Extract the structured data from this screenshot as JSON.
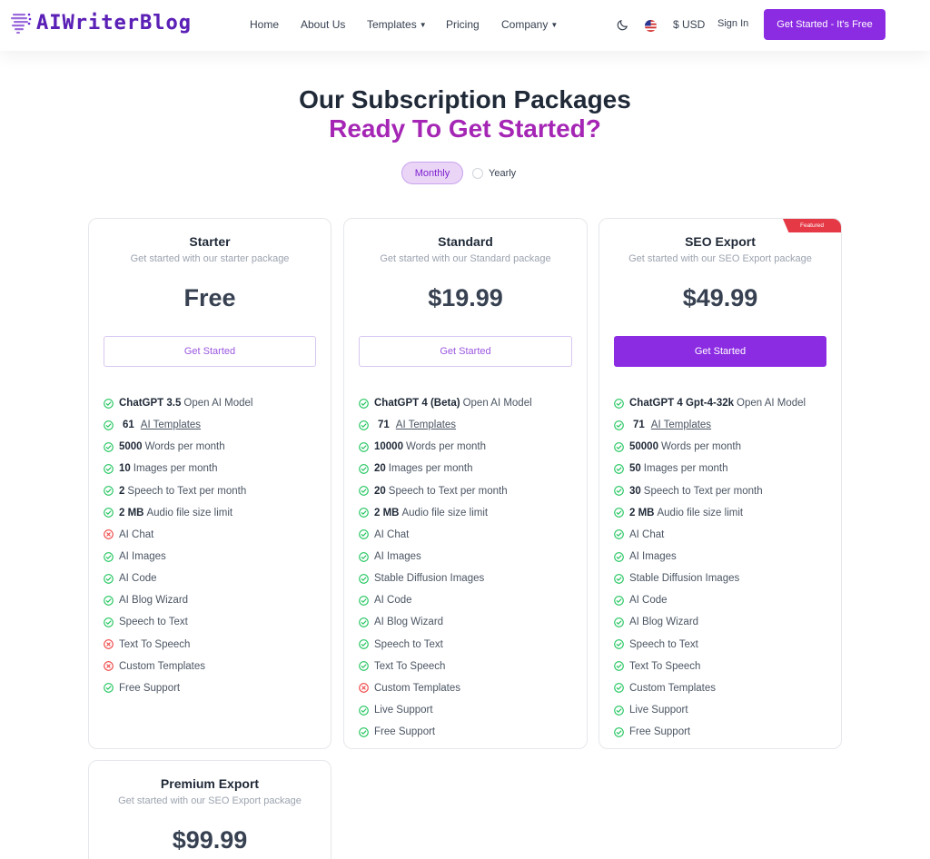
{
  "brand": {
    "name": "AIWriterBlog"
  },
  "nav": {
    "home": "Home",
    "about": "About Us",
    "templates": "Templates",
    "pricing": "Pricing",
    "company": "Company"
  },
  "header": {
    "currency": "$ USD",
    "sign_in": "Sign In",
    "cta": "Get Started - It's Free"
  },
  "hero": {
    "title": "Our Subscription Packages",
    "subtitle": "Ready To Get Started?",
    "billing_options": [
      "Monthly",
      "Yearly"
    ],
    "billing_selected": "Monthly"
  },
  "colors": {
    "accent": "#8b2be2",
    "subtitle": "#a526b5",
    "check": "#22c55e",
    "cross": "#ef4444",
    "ribbon": "#e53945"
  },
  "plans": [
    {
      "name": "Starter",
      "desc": "Get started with our starter package",
      "price": "Free",
      "button": "Get Started",
      "features": [
        {
          "ok": true,
          "b": "ChatGPT 3.5",
          "t": "Open AI Model"
        },
        {
          "ok": true,
          "n": "61",
          "t": "AI Templates",
          "link": true
        },
        {
          "ok": true,
          "b": "5000",
          "t": "Words per month"
        },
        {
          "ok": true,
          "b": "10",
          "t": "Images per month"
        },
        {
          "ok": true,
          "b": "2",
          "t": "Speech to Text per month"
        },
        {
          "ok": true,
          "b": "2 MB",
          "t": "Audio file size limit"
        },
        {
          "ok": false,
          "t": "AI Chat"
        },
        {
          "ok": true,
          "t": "AI Images"
        },
        {
          "ok": true,
          "t": "AI Code"
        },
        {
          "ok": true,
          "t": "AI Blog Wizard"
        },
        {
          "ok": true,
          "t": "Speech to Text"
        },
        {
          "ok": false,
          "t": "Text To Speech"
        },
        {
          "ok": false,
          "t": "Custom Templates"
        },
        {
          "ok": true,
          "t": "Free Support"
        }
      ]
    },
    {
      "name": "Standard",
      "desc": "Get started with our Standard package",
      "price": "$19.99",
      "button": "Get Started",
      "features": [
        {
          "ok": true,
          "b": "ChatGPT 4 (Beta)",
          "t": "Open AI Model"
        },
        {
          "ok": true,
          "n": "71",
          "t": "AI Templates",
          "link": true
        },
        {
          "ok": true,
          "b": "10000",
          "t": "Words per month"
        },
        {
          "ok": true,
          "b": "20",
          "t": "Images per month"
        },
        {
          "ok": true,
          "b": "20",
          "t": "Speech to Text per month"
        },
        {
          "ok": true,
          "b": "2 MB",
          "t": "Audio file size limit"
        },
        {
          "ok": true,
          "t": "AI Chat"
        },
        {
          "ok": true,
          "t": "AI Images"
        },
        {
          "ok": true,
          "t": "Stable Diffusion Images"
        },
        {
          "ok": true,
          "t": "AI Code"
        },
        {
          "ok": true,
          "t": "AI Blog Wizard"
        },
        {
          "ok": true,
          "t": "Speech to Text"
        },
        {
          "ok": true,
          "t": "Text To Speech"
        },
        {
          "ok": false,
          "t": "Custom Templates"
        },
        {
          "ok": true,
          "t": "Live Support"
        },
        {
          "ok": true,
          "t": "Free Support"
        }
      ]
    },
    {
      "name": "SEO Export",
      "desc": "Get started with our SEO Export package",
      "price": "$49.99",
      "button": "Get Started",
      "ribbon": "Featured",
      "features": [
        {
          "ok": true,
          "b": "ChatGPT 4 Gpt-4-32k",
          "t": "Open AI Model"
        },
        {
          "ok": true,
          "n": "71",
          "t": "AI Templates",
          "link": true
        },
        {
          "ok": true,
          "b": "50000",
          "t": "Words per month"
        },
        {
          "ok": true,
          "b": "50",
          "t": "Images per month"
        },
        {
          "ok": true,
          "b": "30",
          "t": "Speech to Text per month"
        },
        {
          "ok": true,
          "b": "2 MB",
          "t": "Audio file size limit"
        },
        {
          "ok": true,
          "t": "AI Chat"
        },
        {
          "ok": true,
          "t": "AI Images"
        },
        {
          "ok": true,
          "t": "Stable Diffusion Images"
        },
        {
          "ok": true,
          "t": "AI Code"
        },
        {
          "ok": true,
          "t": "AI Blog Wizard"
        },
        {
          "ok": true,
          "t": "Speech to Text"
        },
        {
          "ok": true,
          "t": "Text To Speech"
        },
        {
          "ok": true,
          "t": "Custom Templates"
        },
        {
          "ok": true,
          "t": "Live Support"
        },
        {
          "ok": true,
          "t": "Free Support"
        }
      ]
    },
    {
      "name": "Premium Export",
      "desc": "Get started with our SEO Export package",
      "price": "$99.99"
    }
  ]
}
